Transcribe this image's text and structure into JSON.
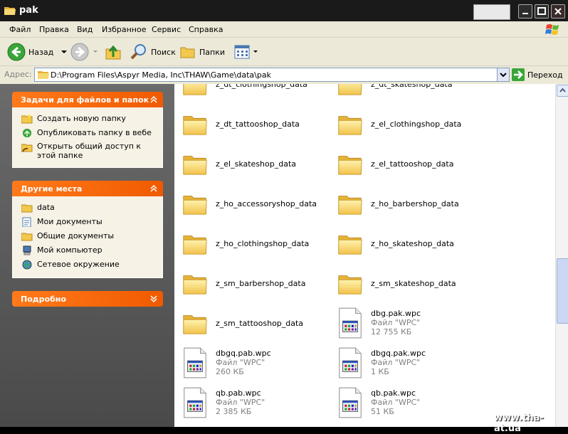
{
  "window": {
    "title": "pak"
  },
  "menu": [
    "Файл",
    "Правка",
    "Вид",
    "Избранное",
    "Сервис",
    "Справка"
  ],
  "toolbar": {
    "back": "Назад",
    "search": "Поиск",
    "folders": "Папки"
  },
  "address": {
    "label": "Адрес:",
    "path": "D:\\Program Files\\Aspyr Media, Inc\\THAW\\Game\\data\\pak",
    "go": "Переход"
  },
  "tasks": {
    "title": "Задачи для файлов и папок",
    "items": [
      "Создать новую папку",
      "Опубликовать папку в вебе",
      "Открыть общий доступ к этой папке"
    ]
  },
  "places": {
    "title": "Другие места",
    "items": [
      "data",
      "Мои документы",
      "Общие документы",
      "Мой компьютер",
      "Сетевое окружение"
    ]
  },
  "details": {
    "title": "Подробно"
  },
  "files": [
    {
      "name": "z_dt_clothingshop_data",
      "kind": "folder"
    },
    {
      "name": "z_dt_skateshop_data",
      "kind": "folder"
    },
    {
      "name": "z_dt_tattooshop_data",
      "kind": "folder"
    },
    {
      "name": "z_el_clothingshop_data",
      "kind": "folder"
    },
    {
      "name": "z_el_skateshop_data",
      "kind": "folder"
    },
    {
      "name": "z_el_tattooshop_data",
      "kind": "folder"
    },
    {
      "name": "z_ho_accessoryshop_data",
      "kind": "folder"
    },
    {
      "name": "z_ho_barbershop_data",
      "kind": "folder"
    },
    {
      "name": "z_ho_clothingshop_data",
      "kind": "folder"
    },
    {
      "name": "z_ho_skateshop_data",
      "kind": "folder"
    },
    {
      "name": "z_sm_barbershop_data",
      "kind": "folder"
    },
    {
      "name": "z_sm_skateshop_data",
      "kind": "folder"
    },
    {
      "name": "z_sm_tattooshop_data",
      "kind": "folder"
    },
    {
      "name": "dbg.pak.wpc",
      "kind": "file",
      "type": "Файл \"WPC\"",
      "size": "12 755 КБ"
    },
    {
      "name": "dbgq.pab.wpc",
      "kind": "file",
      "type": "Файл \"WPC\"",
      "size": "260 КБ"
    },
    {
      "name": "dbgq.pak.wpc",
      "kind": "file",
      "type": "Файл \"WPC\"",
      "size": "1 КБ"
    },
    {
      "name": "qb.pab.wpc",
      "kind": "file",
      "type": "Файл \"WPC\"",
      "size": "2 385 КБ"
    },
    {
      "name": "qb.pak.wpc",
      "kind": "file",
      "type": "Файл \"WPC\"",
      "size": "51 КБ"
    }
  ],
  "watermark": "www.tha-at.ua"
}
